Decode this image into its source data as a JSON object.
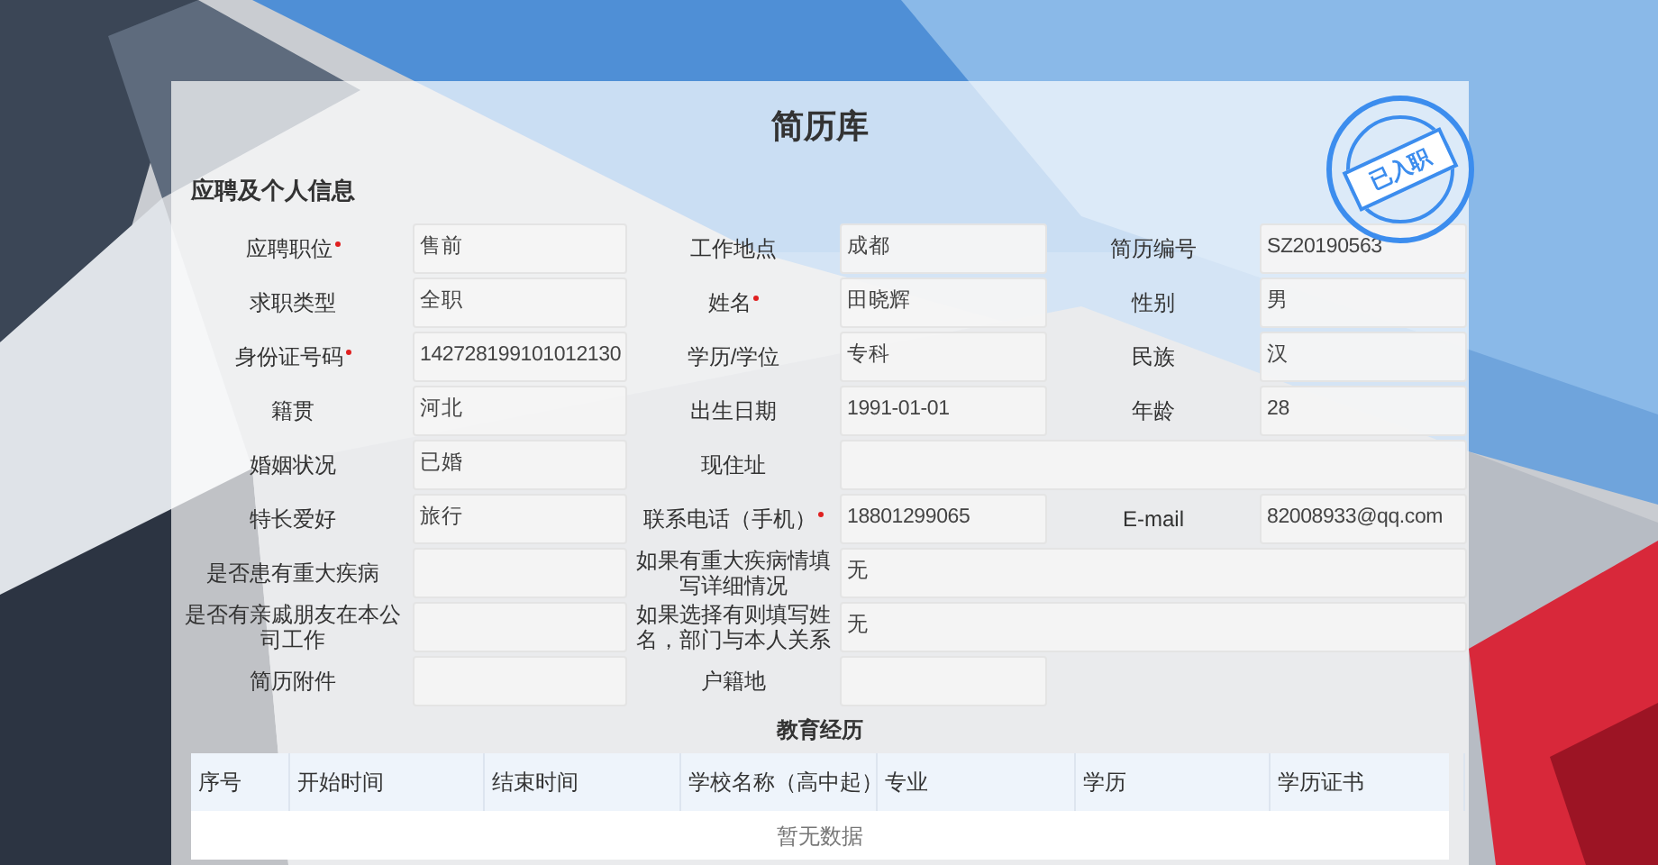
{
  "title": "简历库",
  "stamp": "已入职",
  "section": "应聘及个人信息",
  "fields": [
    {
      "label": "应聘职位",
      "required": true,
      "value": "售前",
      "kind": "normal"
    },
    {
      "label": "工作地点",
      "required": false,
      "value": "成都",
      "kind": "normal"
    },
    {
      "label": "简历编号",
      "required": false,
      "value": "SZ20190563",
      "kind": "normal"
    },
    {
      "label": "求职类型",
      "required": false,
      "value": "全职",
      "kind": "normal"
    },
    {
      "label": "姓名",
      "required": true,
      "value": "田晓辉",
      "kind": "normal"
    },
    {
      "label": "性别",
      "required": false,
      "value": "男",
      "kind": "normal"
    },
    {
      "label": "身份证号码",
      "required": true,
      "value": "142728199101012130",
      "kind": "normal"
    },
    {
      "label": "学历/学位",
      "required": false,
      "value": "专科",
      "kind": "normal"
    },
    {
      "label": "民族",
      "required": false,
      "value": "汉",
      "kind": "normal"
    },
    {
      "label": "籍贯",
      "required": false,
      "value": "河北",
      "kind": "normal"
    },
    {
      "label": "出生日期",
      "required": false,
      "value": "1991-01-01",
      "kind": "normal"
    },
    {
      "label": "年龄",
      "required": false,
      "value": "28",
      "kind": "normal"
    },
    {
      "label": "婚姻状况",
      "required": false,
      "value": "已婚",
      "kind": "normal"
    },
    {
      "label": "现住址",
      "required": false,
      "kind": "wide"
    },
    {
      "label": "特长爱好",
      "required": false,
      "value": "旅行",
      "kind": "normal"
    },
    {
      "label": "联系电话（手机）",
      "required": true,
      "value": "18801299065",
      "kind": "normal"
    },
    {
      "label": "E-mail",
      "required": false,
      "value": "82008933@qq.com",
      "kind": "normal"
    },
    {
      "label": "是否患有重大疾病",
      "required": false,
      "kind": "normal"
    },
    {
      "label": "如果有重大疾病情填写详细情况",
      "required": false,
      "value": "无",
      "kind": "wide"
    },
    {
      "label": "是否有亲戚朋友在本公司工作",
      "required": false,
      "kind": "normal"
    },
    {
      "label": "如果选择有则填写姓名，部门与本人关系",
      "required": false,
      "value": "无",
      "kind": "wide"
    },
    {
      "label": "简历附件",
      "required": false,
      "kind": "normal"
    },
    {
      "label": "户籍地",
      "required": false,
      "kind": "normal"
    }
  ],
  "education": {
    "title": "教育经历",
    "columns": [
      "序号",
      "开始时间",
      "结束时间",
      "学校名称（高中起）",
      "专业",
      "学历",
      "学历证书"
    ],
    "empty_text": "暂无数据"
  }
}
